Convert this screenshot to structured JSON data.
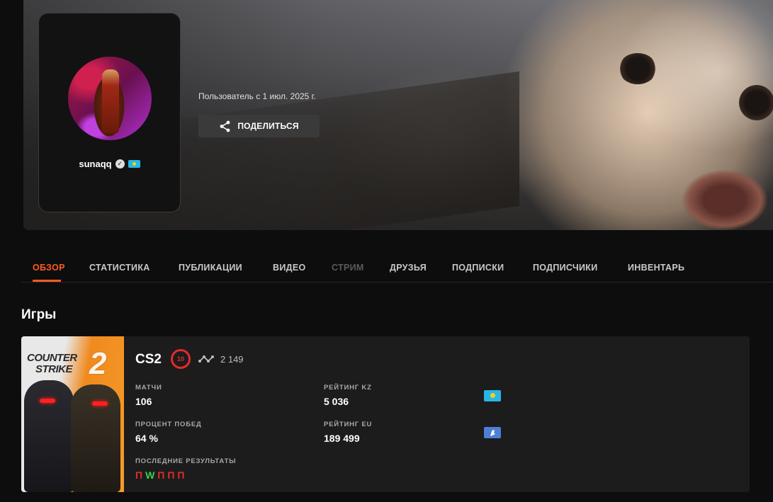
{
  "profile": {
    "username": "sunaqq",
    "member_since": "Пользователь с 1 июл. 2025 г.",
    "share_label": "ПОДЕЛИТЬСЯ"
  },
  "tabs": [
    {
      "label": "ОБЗОР",
      "state": "active"
    },
    {
      "label": "СТАТИСТИКА",
      "state": "normal"
    },
    {
      "label": "ПУБЛИКАЦИИ",
      "state": "normal"
    },
    {
      "label": "ВИДЕО",
      "state": "normal"
    },
    {
      "label": "СТРИМ",
      "state": "disabled"
    },
    {
      "label": "ДРУЗЬЯ",
      "state": "normal"
    },
    {
      "label": "ПОДПИСКИ",
      "state": "normal"
    },
    {
      "label": "ПОДПИСЧИКИ",
      "state": "normal"
    },
    {
      "label": "ИНВЕНТАРЬ",
      "state": "normal"
    }
  ],
  "games_section": {
    "title": "Игры",
    "game": {
      "cover_title_line1": "COUNTER",
      "cover_title_line2": "STRIKE",
      "cover_number": "2",
      "name": "CS2",
      "level": "10",
      "elo": "2 149",
      "stats": {
        "matches_label": "МАТЧИ",
        "matches_value": "106",
        "winrate_label": "ПРОЦЕНТ ПОБЕД",
        "winrate_value": "64 %",
        "rating_kz_label": "РЕЙТИНГ KZ",
        "rating_kz_value": "5 036",
        "rating_eu_label": "РЕЙТИНГ EU",
        "rating_eu_value": "189 499",
        "recent_label": "ПОСЛЕДНИЕ РЕЗУЛЬТАТЫ",
        "recent_results": [
          "П",
          "W",
          "П",
          "П",
          "П"
        ]
      }
    }
  },
  "colors": {
    "accent": "#ff5a1f",
    "loss": "#e52a2a",
    "win": "#3bd14b",
    "background": "#0d0d0d",
    "card": "#1c1c1c"
  }
}
